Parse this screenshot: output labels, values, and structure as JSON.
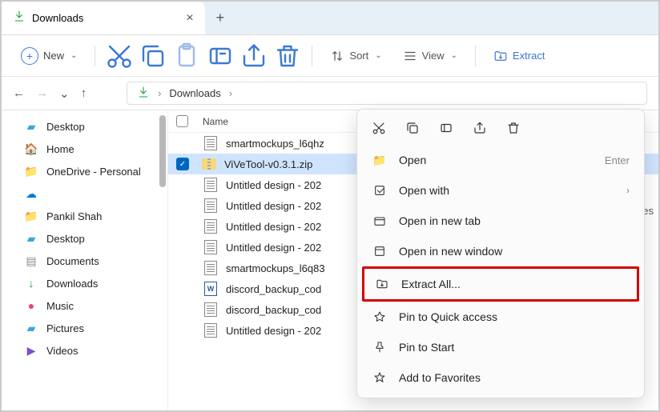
{
  "tab": {
    "title": "Downloads"
  },
  "toolbar": {
    "new_label": "New",
    "sort_label": "Sort",
    "view_label": "View",
    "extract_label": "Extract"
  },
  "breadcrumb": {
    "folder": "Downloads"
  },
  "sidebar": {
    "items": [
      {
        "label": "Desktop"
      },
      {
        "label": "Home"
      },
      {
        "label": "OneDrive - Personal"
      },
      {
        "label": "Pankil Shah"
      },
      {
        "label": "Desktop"
      },
      {
        "label": "Documents"
      },
      {
        "label": "Downloads"
      },
      {
        "label": "Music"
      },
      {
        "label": "Pictures"
      },
      {
        "label": "Videos"
      }
    ]
  },
  "columns": {
    "name": "Name"
  },
  "files": [
    {
      "name": "smartmockups_l6qhz"
    },
    {
      "name": "ViVeTool-v0.3.1.zip"
    },
    {
      "name": "Untitled design - 202"
    },
    {
      "name": "Untitled design - 202"
    },
    {
      "name": "Untitled design - 202"
    },
    {
      "name": "Untitled design - 202"
    },
    {
      "name": "smartmockups_l6q83"
    },
    {
      "name": "discord_backup_cod"
    },
    {
      "name": "discord_backup_cod"
    },
    {
      "name": "Untitled design - 202"
    }
  ],
  "ctx": {
    "open": "Open",
    "open_hint": "Enter",
    "open_with": "Open with",
    "open_new_tab": "Open in new tab",
    "open_new_window": "Open in new window",
    "extract_all": "Extract All...",
    "pin_quick": "Pin to Quick access",
    "pin_start": "Pin to Start",
    "add_fav": "Add to Favorites"
  },
  "edge_text": "es"
}
